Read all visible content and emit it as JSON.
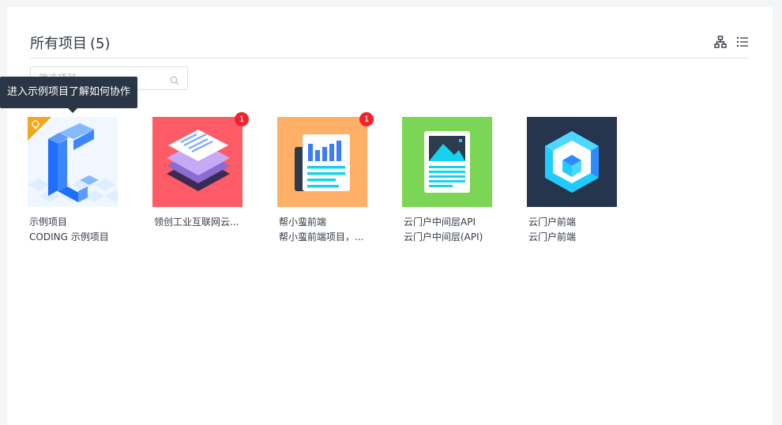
{
  "header": {
    "title": "所有项目",
    "count": "(5)"
  },
  "search": {
    "placeholder": "筛选项目"
  },
  "tooltip": {
    "text": "进入示例项目了解如何协作"
  },
  "view_icons": [
    "org-tree-icon",
    "list-view-icon"
  ],
  "projects": [
    {
      "name": "示例项目",
      "description": "CODING 示例项目",
      "badge": "",
      "bg": "#f0f7ff",
      "icon": "coding-c-icon"
    },
    {
      "name": "领创工业互联网云...",
      "description": "",
      "badge": "1",
      "bg": "#fd5b66",
      "icon": "layered-docs-icon"
    },
    {
      "name": "帮小蛮前端",
      "description": "帮小蛮前端项目，...",
      "badge": "1",
      "bg": "#ffb066",
      "icon": "report-chart-icon"
    },
    {
      "name": "云门户中间层API",
      "description": "云门户中间层(API)",
      "badge": "",
      "bg": "#7ad654",
      "icon": "document-image-icon"
    },
    {
      "name": "云门户前端",
      "description": "云门户前端",
      "badge": "",
      "bg": "#25354d",
      "icon": "cube-icon"
    }
  ]
}
